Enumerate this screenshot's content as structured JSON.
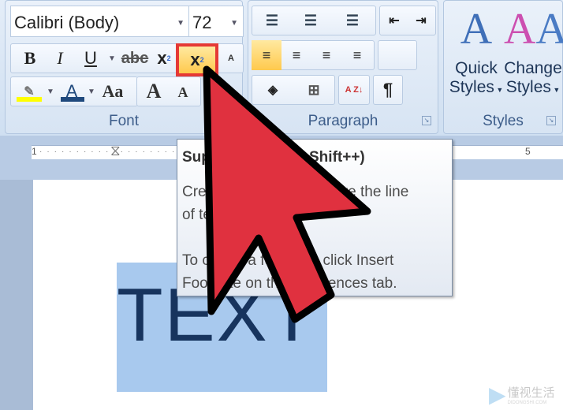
{
  "font_group": {
    "label": "Font",
    "font_name": "Calibri (Body)",
    "font_size": "72",
    "buttons": {
      "bold": "B",
      "italic": "I",
      "underline": "U",
      "strike": "abc",
      "subscript": "x",
      "superscript": "x",
      "clear": "A",
      "highlight_color": "#ffff00",
      "font_color": "#1f497d",
      "case": "Aa",
      "grow": "A",
      "shrink": "A"
    }
  },
  "paragraph_group": {
    "label": "Paragraph",
    "sort": "A Z",
    "pilcrow": "¶"
  },
  "styles_group": {
    "label": "Styles",
    "quick_styles": [
      "Quick",
      "Styles"
    ],
    "change_styles": [
      "Change",
      "Styles"
    ]
  },
  "ruler": {
    "left_number": "1",
    "right_number": "5"
  },
  "tooltip": {
    "title": "Superscript (Ctrl+Shift++)",
    "line1": "Create small letters above the line",
    "line2": "of text.",
    "line3": "To create a footnote, click Insert",
    "line4": "Footnote on the References tab."
  },
  "document": {
    "text": "TEXT",
    "highlight": "#a8c9ee"
  },
  "annotation": {
    "arrow_color": "#e0313f",
    "highlight_box_color": "#e53935"
  },
  "watermark": {
    "name": "懂视生活",
    "domain": "DIDONGSHI.COM"
  }
}
